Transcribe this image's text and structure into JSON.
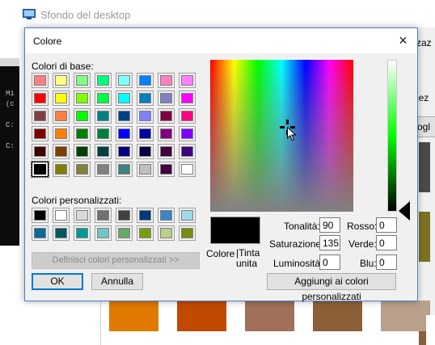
{
  "background": {
    "title": "Sfondo del desktop",
    "cmd_lines": [
      "Mi",
      "(c",
      "",
      "C:",
      "",
      "C:"
    ],
    "right_text_1": "zaz",
    "right_text_2": "lez",
    "right_button": "ogl",
    "bottom_swatches": [
      "#e07900",
      "#c14a00",
      "#a0705a",
      "#8b6038",
      "#b9a08a"
    ],
    "right_swatches": [
      "#4a4a4a",
      "#7a7223",
      "#876040"
    ]
  },
  "dialog": {
    "title": "Colore",
    "close_glyph": "×",
    "basic_colors_label": "Colori di base:",
    "basic_colors": [
      [
        "#ff8080",
        "#ffff80",
        "#80ff80",
        "#00ff80",
        "#80ffff",
        "#0080ff",
        "#ff80c0",
        "#ff80ff"
      ],
      [
        "#ff0000",
        "#ffff00",
        "#80ff00",
        "#00ff40",
        "#00ffff",
        "#0080c0",
        "#8080c0",
        "#ff00ff"
      ],
      [
        "#804040",
        "#ff8040",
        "#00ff00",
        "#008080",
        "#004080",
        "#8080ff",
        "#800040",
        "#ff0080"
      ],
      [
        "#800000",
        "#ff8000",
        "#008000",
        "#008040",
        "#0000ff",
        "#0000a0",
        "#800080",
        "#8000ff"
      ],
      [
        "#400000",
        "#804000",
        "#004000",
        "#004040",
        "#000080",
        "#000040",
        "#400040",
        "#400080"
      ],
      [
        "#000000",
        "#808000",
        "#808040",
        "#808080",
        "#408080",
        "#c0c0c0",
        "#400040",
        "#ffffff"
      ]
    ],
    "selected_basic_color": "#000000",
    "custom_colors_label": "Colori personalizzati:",
    "custom_colors": [
      [
        "#000000",
        "#ffffff",
        "#d8d8d8",
        "#707070",
        "#404040",
        "#003a78",
        "#3a84c8",
        "#a0d8ec"
      ],
      [
        "#0a6b98",
        "#005860",
        "#009a96",
        "#70c6c4",
        "#68a868",
        "#789e10",
        "#b8d088",
        "#7a8c10"
      ]
    ],
    "define_custom_button": "Definisci colori personalizzati >>",
    "ok_button": "OK",
    "cancel_button": "Annulla",
    "preview_label_1": "Colore",
    "preview_label_2": "|Tinta\nunita",
    "preview_color": "#000000",
    "hue_label": "Tonalità:",
    "hue_value": "90",
    "saturation_label": "Saturazione:",
    "saturation_value": "135",
    "luminosity_label": "Luminosità:",
    "luminosity_value": "0",
    "red_label": "Rosso:",
    "red_value": "0",
    "green_label": "Verde:",
    "green_value": "0",
    "blue_label": "Blu:",
    "blue_value": "0",
    "add_custom_button": "Aggiungi ai colori personalizzati"
  }
}
